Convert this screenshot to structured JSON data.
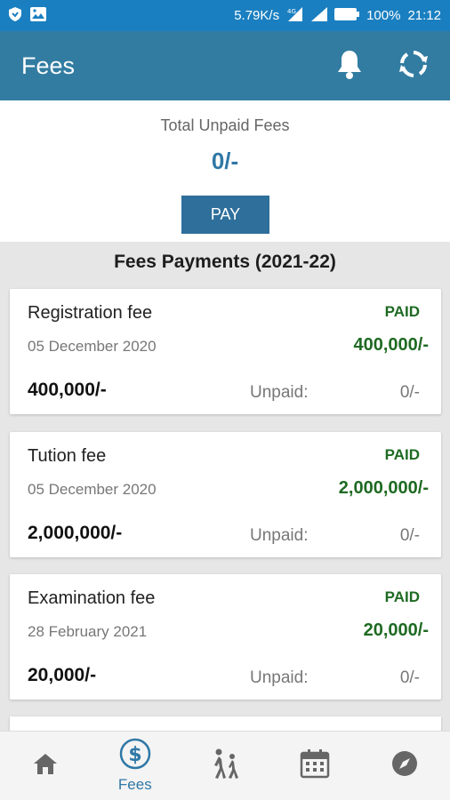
{
  "statusbar": {
    "speed": "5.79K/s",
    "battery": "100%",
    "time": "21:12"
  },
  "appbar": {
    "title": "Fees"
  },
  "summary": {
    "label": "Total Unpaid Fees",
    "amount": "0/-",
    "pay_label": "PAY"
  },
  "section_title": "Fees Payments (2021-22)",
  "fees": [
    {
      "name": "Registration fee",
      "status": "PAID",
      "date": "05 December 2020",
      "paid_amount": "400,000/-",
      "total": "400,000/-",
      "unpaid_label": "Unpaid:",
      "unpaid_value": "0/-"
    },
    {
      "name": "Tution fee",
      "status": "PAID",
      "date": "05 December 2020",
      "paid_amount": "2,000,000/-",
      "total": "2,000,000/-",
      "unpaid_label": "Unpaid:",
      "unpaid_value": "0/-"
    },
    {
      "name": "Examination fee",
      "status": "PAID",
      "date": "28 February 2021",
      "paid_amount": "20,000/-",
      "total": "20,000/-",
      "unpaid_label": "Unpaid:",
      "unpaid_value": "0/-"
    }
  ],
  "bottomnav": {
    "items": [
      {
        "icon": "home-icon",
        "label": ""
      },
      {
        "icon": "dollar-icon",
        "label": "Fees"
      },
      {
        "icon": "walking-icon",
        "label": ""
      },
      {
        "icon": "calendar-icon",
        "label": ""
      },
      {
        "icon": "compass-icon",
        "label": ""
      }
    ]
  },
  "colors": {
    "statusbar": "#1a7fc0",
    "appbar": "#327ca1",
    "accent": "#2f78a6",
    "paid": "#1e6a22"
  }
}
